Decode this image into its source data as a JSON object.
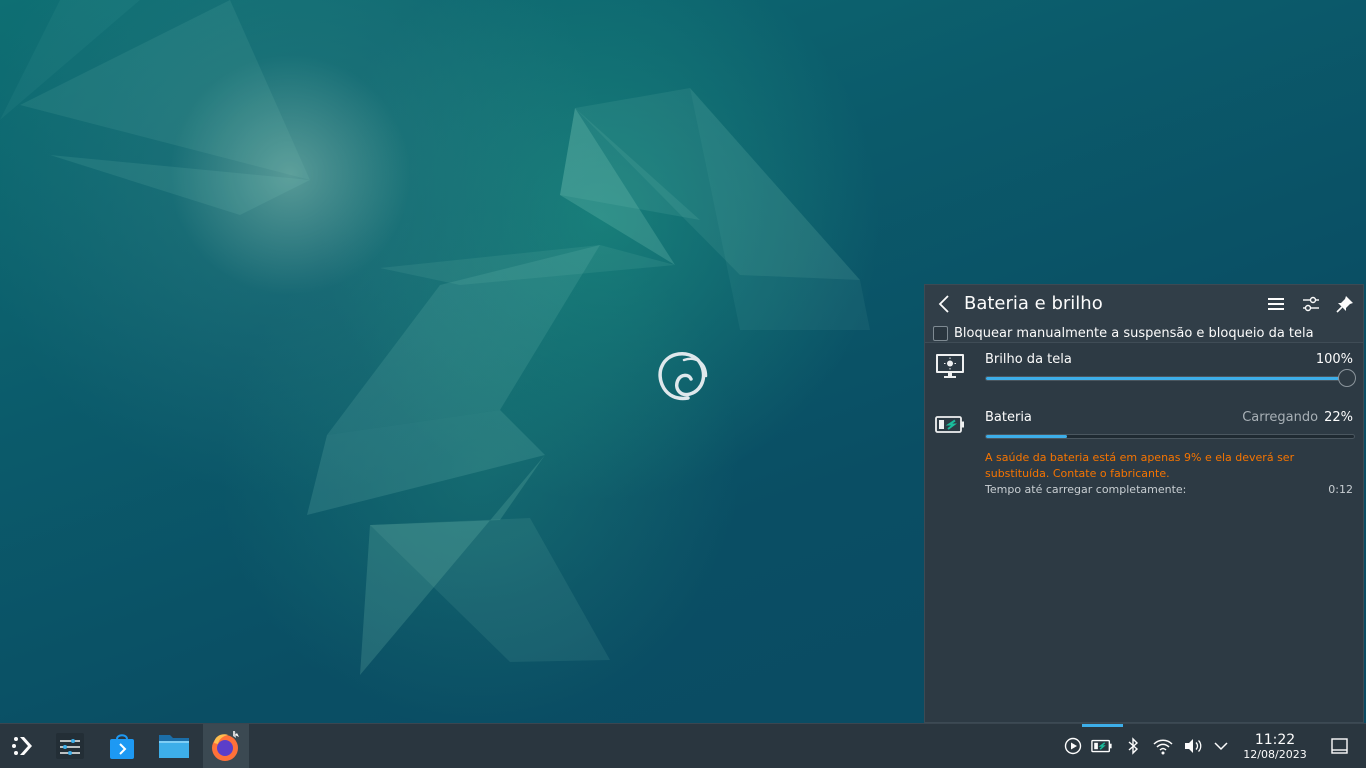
{
  "popup": {
    "title": "Bateria e brilho",
    "icons": {
      "back": "chevron-left-icon",
      "menu": "hamburger-menu-icon",
      "configure": "configure-sliders-icon",
      "pin": "pin-icon"
    },
    "inhibit_checkbox": {
      "label": "Bloquear manualmente a suspensão e bloqueio da tela",
      "checked": false
    },
    "brightness": {
      "label": "Brilho da tela",
      "value_text": "100%",
      "level": 1.0,
      "icon": "monitor-brightness-icon"
    },
    "battery": {
      "label": "Bateria",
      "status": "Carregando",
      "value_text": "22%",
      "level": 0.22,
      "icon": "battery-charging-icon",
      "warning": "A saúde da bateria está em apenas 9% e ela deverá ser substituída. Contate o fabricante.",
      "time_label": "Tempo até carregar completamente:",
      "time_value": "0:12"
    }
  },
  "taskbar": {
    "launchers": [
      "application-launcher-icon",
      "system-settings-icon",
      "discover-store-icon",
      "file-manager-icon",
      "firefox-icon"
    ],
    "tray": [
      "media-player-icon",
      "battery-icon",
      "bluetooth-icon",
      "wifi-icon",
      "volume-icon",
      "tray-expand-icon"
    ],
    "clock": {
      "time": "11:22",
      "date": "12/08/2023"
    }
  },
  "colors": {
    "accent": "#3daee9",
    "warning": "#f67400",
    "panel": "#2a363f"
  }
}
